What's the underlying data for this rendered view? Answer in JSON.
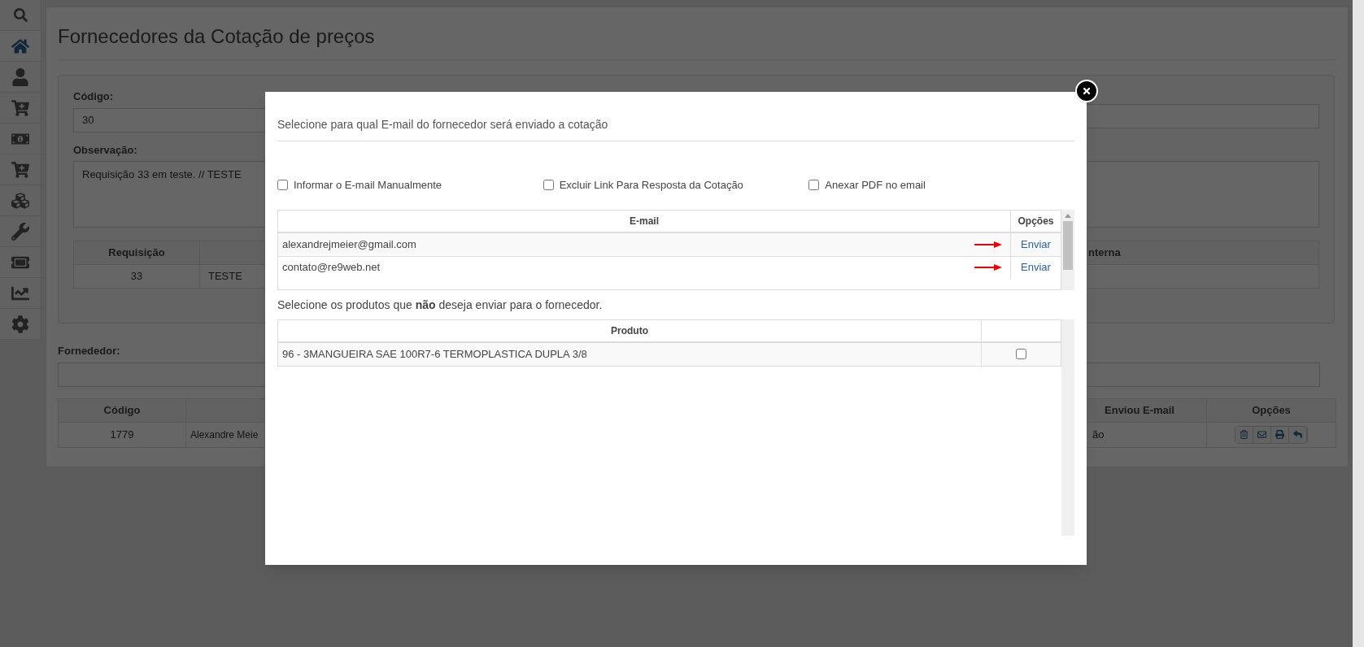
{
  "sidebar": {
    "items": [
      {
        "selected": false
      },
      {
        "selected": true
      },
      {
        "selected": false
      },
      {
        "selected": false
      },
      {
        "selected": false
      },
      {
        "selected": false
      },
      {
        "selected": false
      },
      {
        "selected": false
      },
      {
        "selected": false
      },
      {
        "selected": false
      },
      {
        "selected": false
      }
    ]
  },
  "page": {
    "title": "Fornecedores da Cotação de preços"
  },
  "form": {
    "codigo_label": "Código:",
    "codigo_value": "30",
    "observacao_label": "Observação:",
    "observacao_value": "Requisição 33 em teste. // TESTE"
  },
  "requisition_table": {
    "columns": [
      {
        "label": "Requisição"
      },
      {},
      {
        "label": "nterna"
      }
    ],
    "rows": [
      {
        "cells": [
          "33",
          "TESTE"
        ]
      }
    ]
  },
  "supplier": {
    "label": "Fornededor:",
    "table": {
      "columns": [
        {
          "label": "Código"
        },
        {},
        {
          "label": "Enviou E-mail"
        },
        {
          "label": "Opções"
        }
      ],
      "rows": [
        {
          "cells": [
            "1779",
            "Alexandre Meie",
            "ão"
          ]
        }
      ]
    }
  },
  "modal": {
    "heading": "Selecione para qual E-mail do fornecedor será enviado a cotação",
    "options": [
      {
        "label": "Informar o E-mail Manualmente",
        "checked": false
      },
      {
        "label": "Excluir Link Para Resposta da Cotação",
        "checked": false
      },
      {
        "label": "Anexar PDF no email",
        "checked": false
      }
    ],
    "email_table": {
      "columns": [
        "E-mail",
        "Opções"
      ],
      "rows": [
        {
          "email": "alexandrejmeier@gmail.com",
          "action": "Enviar"
        },
        {
          "email": "contato@re9web.net",
          "action": "Enviar"
        }
      ]
    },
    "products_prompt": "Selecione os produtos que **não** deseja enviar para o fornecedor.",
    "product_table": {
      "columns": [
        "Produto"
      ],
      "rows": [
        {
          "name": "96 - 3MANGUEIRA SAE 100R7-6 TERMOPLASTICA DUPLA 3/8",
          "checked": false
        }
      ]
    }
  }
}
